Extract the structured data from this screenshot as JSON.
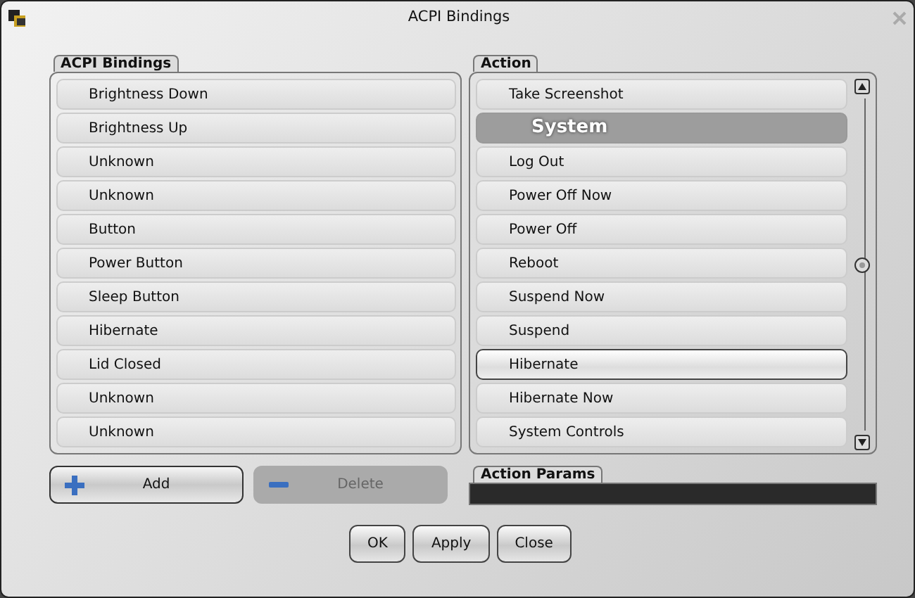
{
  "window": {
    "title": "ACPI Bindings"
  },
  "bindings": {
    "title": "ACPI Bindings",
    "items": [
      {
        "label": "Brightness Down"
      },
      {
        "label": "Brightness Up"
      },
      {
        "label": "Unknown"
      },
      {
        "label": "Unknown"
      },
      {
        "label": "Button"
      },
      {
        "label": "Power Button"
      },
      {
        "label": "Sleep Button"
      },
      {
        "label": "Hibernate"
      },
      {
        "label": "Lid Closed"
      },
      {
        "label": "Unknown"
      },
      {
        "label": "Unknown"
      }
    ]
  },
  "binding_buttons": [
    {
      "label": "Add",
      "kind": "add",
      "disabled": false
    },
    {
      "label": "Delete",
      "kind": "delete",
      "disabled": true
    }
  ],
  "action": {
    "title": "Action",
    "items": [
      {
        "label": "Take Screenshot",
        "kind": "item",
        "selected": false
      },
      {
        "label": "System",
        "kind": "header",
        "selected": false
      },
      {
        "label": "Log Out",
        "kind": "item",
        "selected": false
      },
      {
        "label": "Power Off Now",
        "kind": "item",
        "selected": false
      },
      {
        "label": "Power Off",
        "kind": "item",
        "selected": false
      },
      {
        "label": "Reboot",
        "kind": "item",
        "selected": false
      },
      {
        "label": "Suspend Now",
        "kind": "item",
        "selected": false
      },
      {
        "label": "Suspend",
        "kind": "item",
        "selected": false
      },
      {
        "label": "Hibernate",
        "kind": "item",
        "selected": true
      },
      {
        "label": "Hibernate Now",
        "kind": "item",
        "selected": false
      },
      {
        "label": "System Controls",
        "kind": "item",
        "selected": false
      }
    ]
  },
  "action_params": {
    "title": "Action Params"
  },
  "dialog_buttons": [
    "OK",
    "Apply",
    "Close"
  ]
}
